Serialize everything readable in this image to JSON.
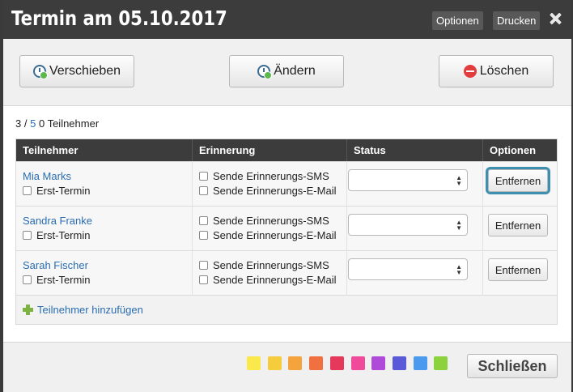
{
  "titlebar": {
    "title": "Termin am 05.10.2017",
    "options_label": "Optionen",
    "print_label": "Drucken"
  },
  "toolbar": {
    "move_label": "Verschieben",
    "edit_label": "Ändern",
    "delete_label": "Löschen"
  },
  "summary": {
    "current": "3",
    "separator": "/",
    "total": "5",
    "rest": "0 Teilnehmer"
  },
  "table": {
    "headers": [
      "Teilnehmer",
      "Erinnerung",
      "Status",
      "Optionen"
    ],
    "rows": [
      {
        "name": "Mia Marks",
        "first_label": "Erst-Termin",
        "sms_label": "Sende Erinnerungs-SMS",
        "email_label": "Sende Erinnerungs-E-Mail",
        "status": "",
        "remove_label": "Entfernen"
      },
      {
        "name": "Sandra Franke",
        "first_label": "Erst-Termin",
        "sms_label": "Sende Erinnerungs-SMS",
        "email_label": "Sende Erinnerungs-E-Mail",
        "status": "",
        "remove_label": "Entfernen"
      },
      {
        "name": "Sarah Fischer",
        "first_label": "Erst-Termin",
        "sms_label": "Sende Erinnerungs-SMS",
        "email_label": "Sende Erinnerungs-E-Mail",
        "status": "",
        "remove_label": "Entfernen"
      }
    ],
    "add_label": "Teilnehmer hinzufügen"
  },
  "footer": {
    "swatches": [
      "#fbe84a",
      "#f5cd3c",
      "#f5a33c",
      "#f07040",
      "#e6385a",
      "#f04a9a",
      "#b04ad8",
      "#5a5ad8",
      "#4a9af0",
      "#8cd23c"
    ],
    "close_label": "Schließen"
  },
  "colors": {
    "titlebar_bg": "#3c3c3c",
    "link": "#2a6db0",
    "focus_ring": "#3e8fb0"
  }
}
